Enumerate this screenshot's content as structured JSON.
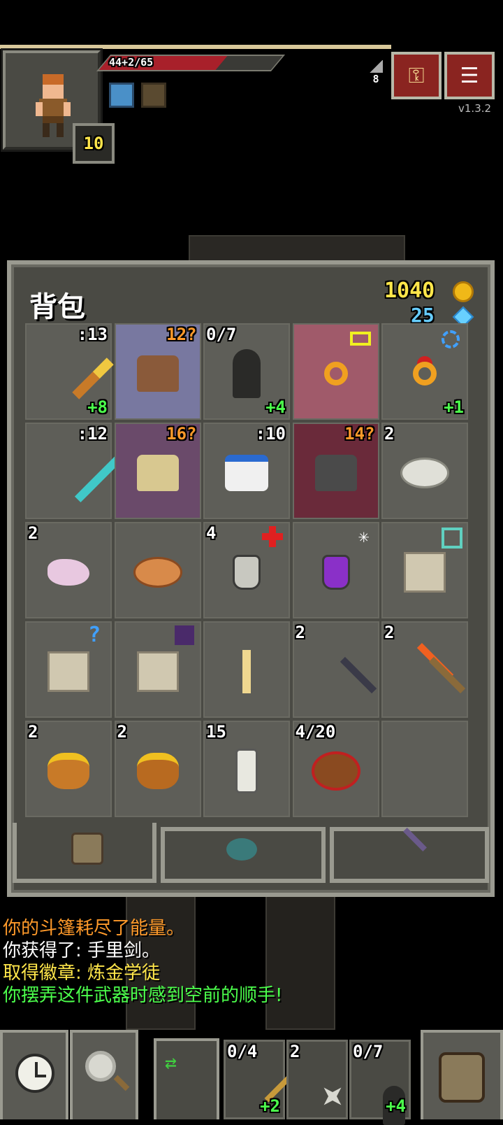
{
  "hero": {
    "hp_text": "44+2/65",
    "hp_fraction": 0.68,
    "level": "10",
    "depth": "8",
    "version": "v1.3.2"
  },
  "top_buttons": {
    "journal_icon": "keys-icon",
    "menu_icon": "menu-icon"
  },
  "inventory": {
    "title": "背包",
    "gold": "1040",
    "energy": "25",
    "slots": [
      {
        "tl": "",
        "tr": ":13",
        "br": "+8",
        "icon": "hammer",
        "bg": "#5e5e58"
      },
      {
        "tl": "",
        "tr": "12?",
        "br": "",
        "icon": "leather-armor",
        "bg": "#7878a0",
        "trc": "#ff9a2a"
      },
      {
        "tl": "0/7",
        "tr": "",
        "br": "+4",
        "icon": "cloak",
        "bg": "#5e5e58"
      },
      {
        "tl": "",
        "tr": "",
        "br": "",
        "icon": "ring-gold",
        "bg": "#a05a6a",
        "badge": "battery"
      },
      {
        "tl": "",
        "tr": "",
        "br": "+1",
        "icon": "ring-gold-red",
        "bg": "#5e5e58",
        "badge": "target"
      },
      {
        "tl": "",
        "tr": ":12",
        "br": "",
        "icon": "sword-cyan",
        "bg": "#5e5e58"
      },
      {
        "tl": "",
        "tr": "16?",
        "br": "",
        "icon": "scale-armor",
        "bg": "#6a4a6a",
        "trc": "#ff9a2a"
      },
      {
        "tl": "",
        "tr": ":10",
        "br": "",
        "icon": "robe",
        "bg": "#5e5e58"
      },
      {
        "tl": "",
        "tr": "14?",
        "br": "",
        "icon": "chain-armor",
        "bg": "#6a2a3a",
        "trc": "#ff9a2a"
      },
      {
        "tl": "2",
        "tr": "",
        "br": "",
        "icon": "stone",
        "bg": "#5e5e58"
      },
      {
        "tl": "2",
        "tr": "",
        "br": "",
        "icon": "crystal",
        "bg": "#5e5e58"
      },
      {
        "tl": "",
        "tr": "",
        "br": "",
        "icon": "pasty",
        "bg": "#5e5e58"
      },
      {
        "tl": "4",
        "tr": "",
        "br": "",
        "icon": "potion-white",
        "bg": "#5e5e58",
        "badge": "redcross"
      },
      {
        "tl": "",
        "tr": "",
        "br": "",
        "icon": "potion-purple",
        "bg": "#5e5e58",
        "badge": "snow"
      },
      {
        "tl": "",
        "tr": "",
        "br": "",
        "icon": "scroll-n",
        "bg": "#5e5e58",
        "badge": "cyanbox"
      },
      {
        "tl": "",
        "tr": "",
        "br": "",
        "icon": "scroll-o",
        "bg": "#5e5e58",
        "badge": "question"
      },
      {
        "tl": "",
        "tr": "",
        "br": "",
        "icon": "scroll-r",
        "bg": "#5e5e58",
        "badge": "skull"
      },
      {
        "tl": "",
        "tr": "",
        "br": "",
        "icon": "ankh",
        "bg": "#5e5e58"
      },
      {
        "tl": "2",
        "tr": "",
        "br": "",
        "icon": "dart",
        "bg": "#5e5e58"
      },
      {
        "tl": "2",
        "tr": "",
        "br": "",
        "icon": "torch",
        "bg": "#5e5e58"
      },
      {
        "tl": "2",
        "tr": "",
        "br": "",
        "icon": "honey-pot",
        "bg": "#5e5e58"
      },
      {
        "tl": "2",
        "tr": "",
        "br": "",
        "icon": "honey-pot-cracked",
        "bg": "#5e5e58"
      },
      {
        "tl": "15",
        "tr": "",
        "br": "",
        "icon": "dew-vial",
        "bg": "#5e5e58"
      },
      {
        "tl": "4/20",
        "tr": "",
        "br": "",
        "icon": "bag",
        "bg": "#5e5e58"
      },
      {
        "tl": "",
        "tr": "",
        "br": "",
        "icon": "empty",
        "bg": "#5e5e58"
      }
    ]
  },
  "log": [
    {
      "text": "你的斗篷耗尽了能量。",
      "color": "#ff9a2a"
    },
    {
      "text": "你获得了: 手里剑。",
      "color": "#ffffff"
    },
    {
      "text": "取得徽章: 炼金学徒",
      "color": "#ffe64a"
    },
    {
      "text": "你摆弄这件武器时感到空前的顺手!",
      "color": "#4cff4c"
    }
  ],
  "quickslots": [
    {
      "tl": "0/4",
      "br": "+2",
      "icon": "wand"
    },
    {
      "tl": "2",
      "br": "",
      "icon": "shuriken"
    },
    {
      "tl": "0/7",
      "br": "+4",
      "icon": "cloak"
    }
  ]
}
